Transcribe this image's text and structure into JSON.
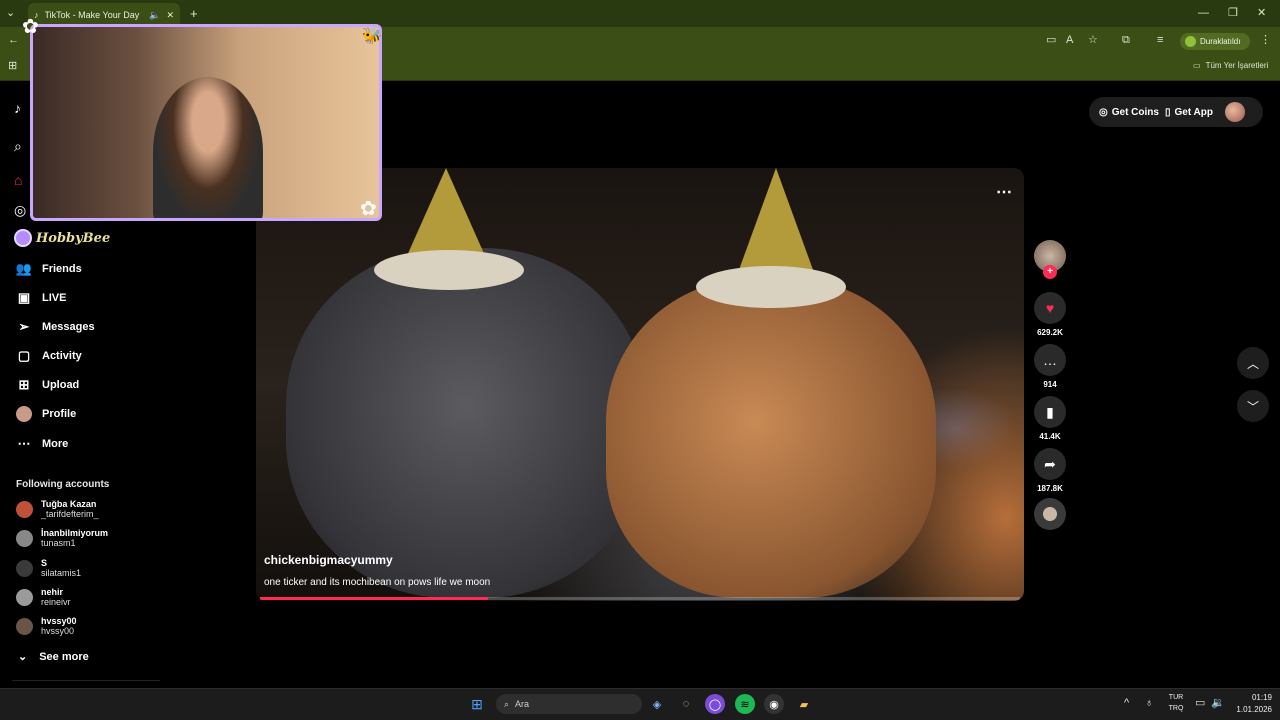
{
  "browser": {
    "tab_title": "TikTok - Make Your Day",
    "profile_status": "Duraklatıldı",
    "bookmarks_label": "Tüm Yer İşaretleri"
  },
  "overlay": {
    "brand": "HobbyBee"
  },
  "sidebar": {
    "items": [
      {
        "label": "Friends",
        "icon": "friends-icon"
      },
      {
        "label": "LIVE",
        "icon": "live-icon"
      },
      {
        "label": "Messages",
        "icon": "messages-icon"
      },
      {
        "label": "Activity",
        "icon": "activity-icon"
      },
      {
        "label": "Upload",
        "icon": "upload-icon"
      },
      {
        "label": "Profile",
        "icon": "profile-avatar"
      },
      {
        "label": "More",
        "icon": "more-icon"
      }
    ],
    "following_title": "Following accounts",
    "accounts": [
      {
        "name": "Tuğba Kazan",
        "handle": "_tarifdefterim_"
      },
      {
        "name": "İnanbilmiyorum",
        "handle": "tunasm1"
      },
      {
        "name": "S",
        "handle": "silatamis1"
      },
      {
        "name": "nehir",
        "handle": "reineivr"
      },
      {
        "name": "hvssy00",
        "handle": "hvssy00"
      }
    ],
    "see_more": "See more"
  },
  "header": {
    "get_coins": "Get Coins",
    "get_app": "Get App"
  },
  "video": {
    "author": "chickenbigmacyummy",
    "caption": "one ticker and its mochibean on pows life we moon",
    "progress": 0.3
  },
  "actions": {
    "likes": "629.2K",
    "comments": "914",
    "saves": "41.4K",
    "shares": "187.8K"
  },
  "taskbar": {
    "search_placeholder": "Ara",
    "lang_top": "TUR",
    "lang_bottom": "TRQ",
    "time": "01:19",
    "date": "1.01.2026"
  },
  "colors": {
    "accent": "#fe2c55",
    "browser": "#3b4e16",
    "overlay_border": "#c9a6ff"
  }
}
